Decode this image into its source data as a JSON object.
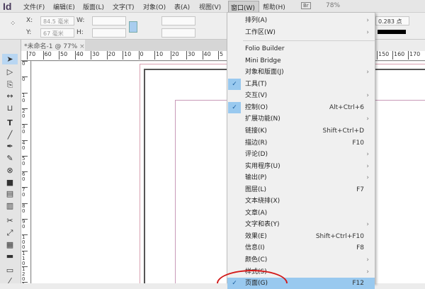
{
  "menubar": {
    "logo": "Id",
    "items": [
      "文件(F)",
      "编辑(E)",
      "版面(L)",
      "文字(T)",
      "对象(O)",
      "表(A)",
      "视图(V)",
      "窗口(W)",
      "帮助(H)"
    ],
    "bridge": "Br",
    "zoom": "78%"
  },
  "control": {
    "x_label": "X:",
    "x_value": "84.5 毫米",
    "y_label": "Y:",
    "y_value": "67 毫米",
    "w_label": "W:",
    "h_label": "H:",
    "stroke_weight": "0.283 点"
  },
  "document_tab": {
    "title": "*未命名-1 @ 77%",
    "close": "×"
  },
  "ruler": {
    "h_labels": [
      "70",
      "60",
      "50",
      "40",
      "30",
      "20",
      "10",
      "0",
      "10",
      "20",
      "30",
      "40",
      "5"
    ],
    "h_labels_right": [
      "150",
      "160",
      "170"
    ],
    "v_labels": [
      "0",
      "0",
      "10",
      "20",
      "30",
      "40",
      "50",
      "60",
      "70",
      "80",
      "90",
      "100",
      "110",
      "120",
      "13"
    ]
  },
  "menu": {
    "items": [
      {
        "label": "排列(A)",
        "submenu": true
      },
      {
        "label": "工作区(W)",
        "submenu": true
      },
      {
        "label": "Folio Builder"
      },
      {
        "label": "Mini Bridge"
      },
      {
        "label": "对象和版面(J)",
        "submenu": true
      },
      {
        "label": "工具(T)",
        "checked": true
      },
      {
        "label": "交互(V)",
        "submenu": true
      },
      {
        "label": "控制(O)",
        "checked": true,
        "shortcut": "Alt+Ctrl+6"
      },
      {
        "label": "扩展功能(N)",
        "submenu": true
      },
      {
        "label": "链接(K)",
        "shortcut": "Shift+Ctrl+D"
      },
      {
        "label": "描边(R)",
        "shortcut": "F10"
      },
      {
        "label": "评论(D)",
        "submenu": true
      },
      {
        "label": "实用程序(U)",
        "submenu": true
      },
      {
        "label": "输出(P)",
        "submenu": true
      },
      {
        "label": "图层(L)",
        "shortcut": "F7"
      },
      {
        "label": "文本绕排(X)"
      },
      {
        "label": "文章(A)"
      },
      {
        "label": "文字和表(Y)",
        "submenu": true
      },
      {
        "label": "效果(E)",
        "shortcut": "Shift+Ctrl+F10"
      },
      {
        "label": "信息(I)",
        "shortcut": "F8"
      },
      {
        "label": "颜色(C)",
        "submenu": true
      },
      {
        "label": "样式(S)",
        "submenu": true
      },
      {
        "label": "页面(G)",
        "checked": true,
        "shortcut": "F12",
        "highlighted": true
      }
    ]
  },
  "colors": {
    "highlight": "#99c9ef",
    "annotation": "#d21818"
  }
}
